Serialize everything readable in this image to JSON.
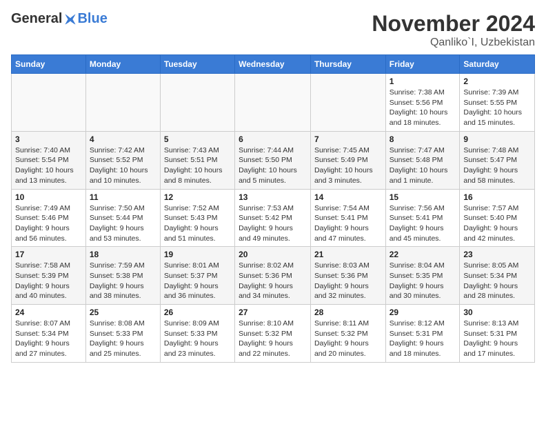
{
  "logo": {
    "general": "General",
    "blue": "Blue"
  },
  "title": "November 2024",
  "subtitle": "Qanliko`I, Uzbekistan",
  "weekdays": [
    "Sunday",
    "Monday",
    "Tuesday",
    "Wednesday",
    "Thursday",
    "Friday",
    "Saturday"
  ],
  "weeks": [
    [
      {
        "day": "",
        "info": ""
      },
      {
        "day": "",
        "info": ""
      },
      {
        "day": "",
        "info": ""
      },
      {
        "day": "",
        "info": ""
      },
      {
        "day": "",
        "info": ""
      },
      {
        "day": "1",
        "info": "Sunrise: 7:38 AM\nSunset: 5:56 PM\nDaylight: 10 hours and 18 minutes."
      },
      {
        "day": "2",
        "info": "Sunrise: 7:39 AM\nSunset: 5:55 PM\nDaylight: 10 hours and 15 minutes."
      }
    ],
    [
      {
        "day": "3",
        "info": "Sunrise: 7:40 AM\nSunset: 5:54 PM\nDaylight: 10 hours and 13 minutes."
      },
      {
        "day": "4",
        "info": "Sunrise: 7:42 AM\nSunset: 5:52 PM\nDaylight: 10 hours and 10 minutes."
      },
      {
        "day": "5",
        "info": "Sunrise: 7:43 AM\nSunset: 5:51 PM\nDaylight: 10 hours and 8 minutes."
      },
      {
        "day": "6",
        "info": "Sunrise: 7:44 AM\nSunset: 5:50 PM\nDaylight: 10 hours and 5 minutes."
      },
      {
        "day": "7",
        "info": "Sunrise: 7:45 AM\nSunset: 5:49 PM\nDaylight: 10 hours and 3 minutes."
      },
      {
        "day": "8",
        "info": "Sunrise: 7:47 AM\nSunset: 5:48 PM\nDaylight: 10 hours and 1 minute."
      },
      {
        "day": "9",
        "info": "Sunrise: 7:48 AM\nSunset: 5:47 PM\nDaylight: 9 hours and 58 minutes."
      }
    ],
    [
      {
        "day": "10",
        "info": "Sunrise: 7:49 AM\nSunset: 5:46 PM\nDaylight: 9 hours and 56 minutes."
      },
      {
        "day": "11",
        "info": "Sunrise: 7:50 AM\nSunset: 5:44 PM\nDaylight: 9 hours and 53 minutes."
      },
      {
        "day": "12",
        "info": "Sunrise: 7:52 AM\nSunset: 5:43 PM\nDaylight: 9 hours and 51 minutes."
      },
      {
        "day": "13",
        "info": "Sunrise: 7:53 AM\nSunset: 5:42 PM\nDaylight: 9 hours and 49 minutes."
      },
      {
        "day": "14",
        "info": "Sunrise: 7:54 AM\nSunset: 5:41 PM\nDaylight: 9 hours and 47 minutes."
      },
      {
        "day": "15",
        "info": "Sunrise: 7:56 AM\nSunset: 5:41 PM\nDaylight: 9 hours and 45 minutes."
      },
      {
        "day": "16",
        "info": "Sunrise: 7:57 AM\nSunset: 5:40 PM\nDaylight: 9 hours and 42 minutes."
      }
    ],
    [
      {
        "day": "17",
        "info": "Sunrise: 7:58 AM\nSunset: 5:39 PM\nDaylight: 9 hours and 40 minutes."
      },
      {
        "day": "18",
        "info": "Sunrise: 7:59 AM\nSunset: 5:38 PM\nDaylight: 9 hours and 38 minutes."
      },
      {
        "day": "19",
        "info": "Sunrise: 8:01 AM\nSunset: 5:37 PM\nDaylight: 9 hours and 36 minutes."
      },
      {
        "day": "20",
        "info": "Sunrise: 8:02 AM\nSunset: 5:36 PM\nDaylight: 9 hours and 34 minutes."
      },
      {
        "day": "21",
        "info": "Sunrise: 8:03 AM\nSunset: 5:36 PM\nDaylight: 9 hours and 32 minutes."
      },
      {
        "day": "22",
        "info": "Sunrise: 8:04 AM\nSunset: 5:35 PM\nDaylight: 9 hours and 30 minutes."
      },
      {
        "day": "23",
        "info": "Sunrise: 8:05 AM\nSunset: 5:34 PM\nDaylight: 9 hours and 28 minutes."
      }
    ],
    [
      {
        "day": "24",
        "info": "Sunrise: 8:07 AM\nSunset: 5:34 PM\nDaylight: 9 hours and 27 minutes."
      },
      {
        "day": "25",
        "info": "Sunrise: 8:08 AM\nSunset: 5:33 PM\nDaylight: 9 hours and 25 minutes."
      },
      {
        "day": "26",
        "info": "Sunrise: 8:09 AM\nSunset: 5:33 PM\nDaylight: 9 hours and 23 minutes."
      },
      {
        "day": "27",
        "info": "Sunrise: 8:10 AM\nSunset: 5:32 PM\nDaylight: 9 hours and 22 minutes."
      },
      {
        "day": "28",
        "info": "Sunrise: 8:11 AM\nSunset: 5:32 PM\nDaylight: 9 hours and 20 minutes."
      },
      {
        "day": "29",
        "info": "Sunrise: 8:12 AM\nSunset: 5:31 PM\nDaylight: 9 hours and 18 minutes."
      },
      {
        "day": "30",
        "info": "Sunrise: 8:13 AM\nSunset: 5:31 PM\nDaylight: 9 hours and 17 minutes."
      }
    ]
  ]
}
